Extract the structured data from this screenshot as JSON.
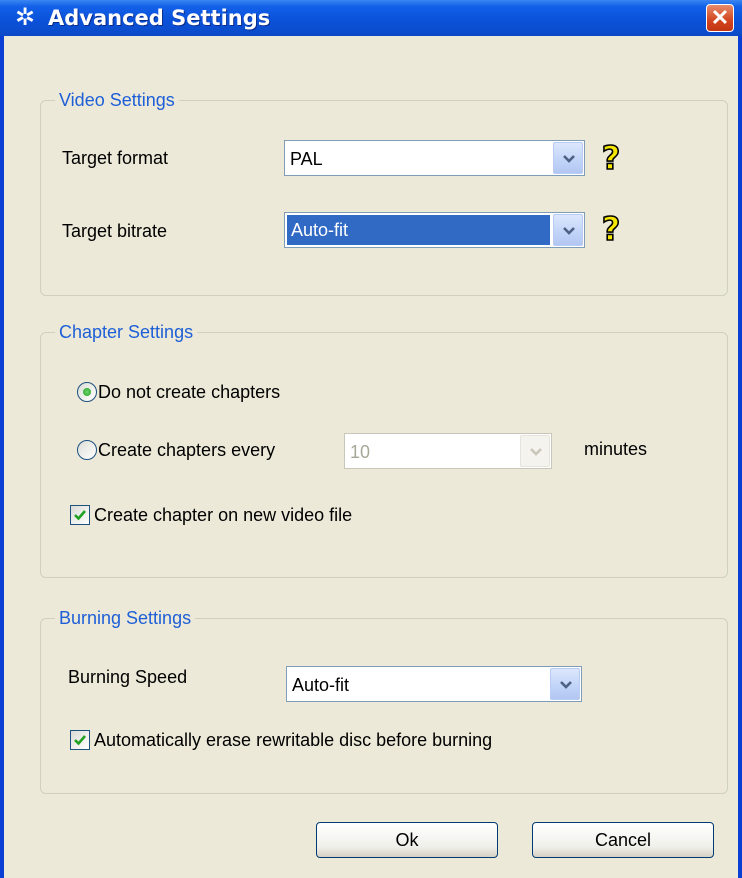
{
  "window": {
    "title": "Advanced Settings",
    "close_glyph": "✕",
    "title_icon": "gear-icon"
  },
  "video": {
    "legend": "Video Settings",
    "target_format_label": "Target format",
    "target_format_value": "PAL",
    "target_bitrate_label": "Target bitrate",
    "target_bitrate_value": "Auto-fit"
  },
  "chapter": {
    "legend": "Chapter Settings",
    "no_chapters_label": "Do not create chapters",
    "no_chapters_checked": true,
    "every_label": "Create chapters every",
    "every_checked": false,
    "every_value": "10",
    "minutes_label": "minutes",
    "on_new_file_label": "Create chapter on new video file",
    "on_new_file_checked": true
  },
  "burning": {
    "legend": "Burning Settings",
    "speed_label": "Burning Speed",
    "speed_value": "Auto-fit",
    "auto_erase_label": "Automatically erase rewritable disc before burning",
    "auto_erase_checked": true
  },
  "buttons": {
    "ok": "Ok",
    "cancel": "Cancel"
  },
  "colors": {
    "titlebar": "#0a52da",
    "legend_text": "#1e5fd7",
    "selection": "#316ac5",
    "dialog_bg": "#ece9d8",
    "close_button": "#d2451f",
    "help_icon": "#f5e600"
  }
}
